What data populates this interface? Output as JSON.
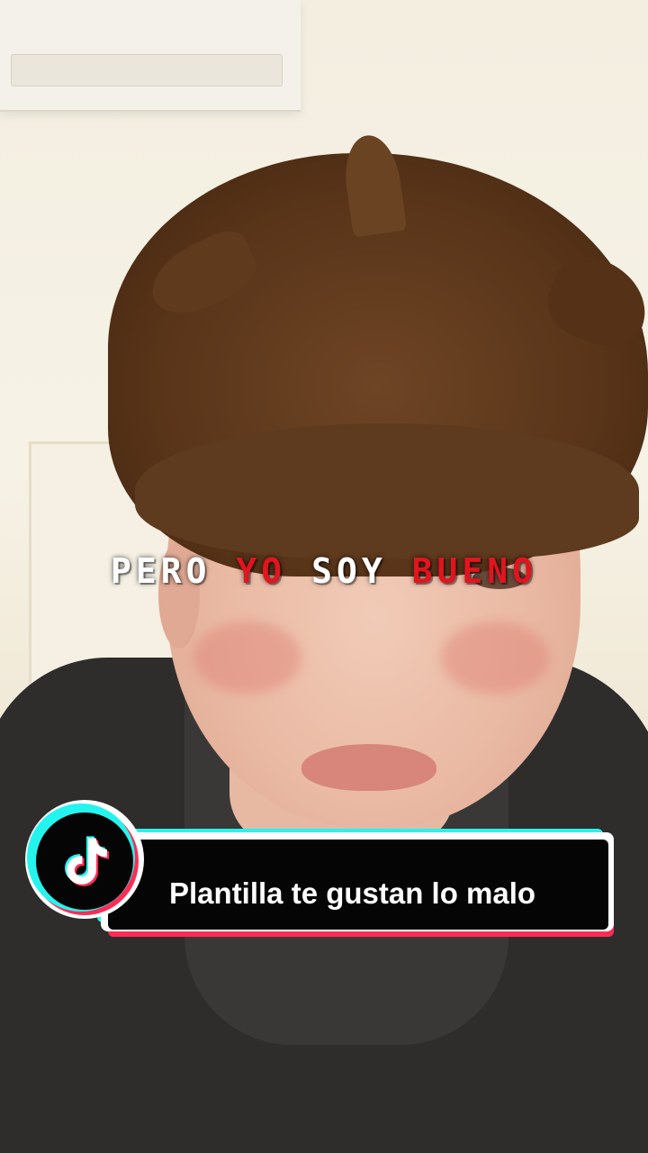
{
  "lyric": {
    "words": [
      "PERO",
      "YO",
      "SOY",
      "BUENO"
    ],
    "colors": {
      "white": "#ffffff",
      "red": "#e2141e"
    }
  },
  "banner": {
    "title": "Plantilla te gustan lo malo",
    "icon": "tiktok-logo-icon",
    "colors": {
      "cyan": "#25f4ee",
      "red": "#fe2c55",
      "background": "#050505",
      "text": "#ffffff"
    }
  }
}
